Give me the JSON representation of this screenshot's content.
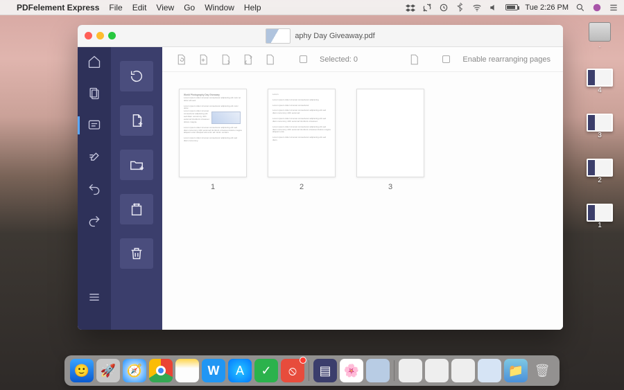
{
  "menubar": {
    "app_name": "PDFelement Express",
    "menus": [
      "File",
      "Edit",
      "View",
      "Go",
      "Window",
      "Help"
    ],
    "clock": "Tue 2:26 PM"
  },
  "window": {
    "filename": "aphy Day Giveaway.pdf"
  },
  "toolbar": {
    "selected_label": "Selected: 0",
    "rearrange_label": "Enable rearranging pages"
  },
  "pages": [
    "1",
    "2",
    "3"
  ],
  "desktop": {
    "items": [
      {
        "label": "."
      },
      {
        "label": "4"
      },
      {
        "label": "3"
      },
      {
        "label": "2"
      },
      {
        "label": "1"
      }
    ]
  }
}
